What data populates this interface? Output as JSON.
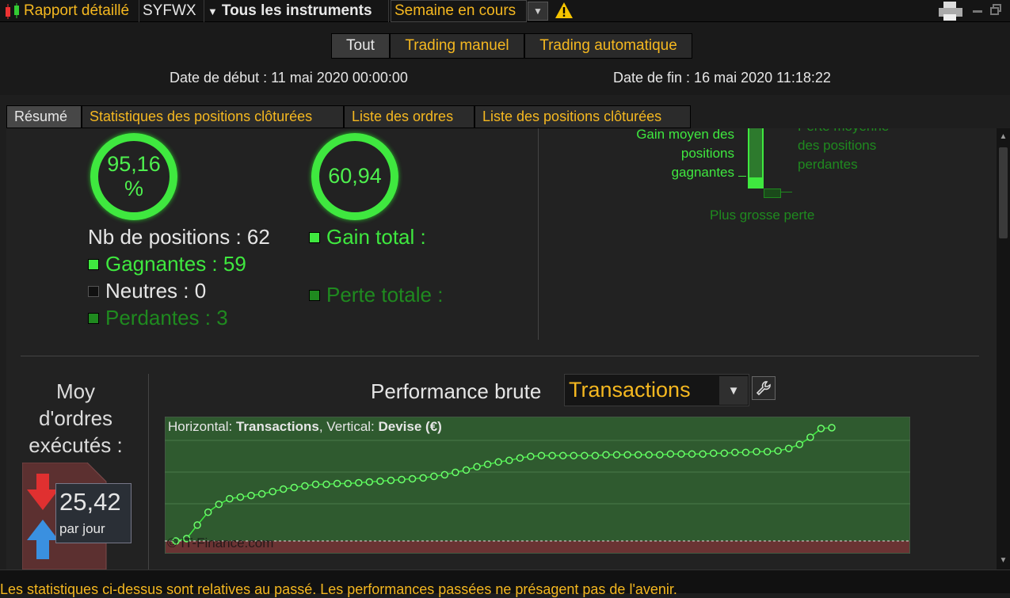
{
  "toolbar": {
    "report_label": "Rapport détaillé",
    "symbol": "SYFWX",
    "instruments": "Tous les instruments",
    "period": "Semaine en cours"
  },
  "filter_tabs": [
    "Tout",
    "Trading manuel",
    "Trading automatique"
  ],
  "dates": {
    "start": "Date de début : 11 mai 2020 00:00:00",
    "end": "Date de fin : 16 mai 2020 11:18:22"
  },
  "tabs": [
    "Résumé",
    "Statistiques des positions clôturées",
    "Liste des ordres",
    "Liste des positions clôturées"
  ],
  "summary": {
    "win_rate": "95,16\n%",
    "ratio": "60,94",
    "positions_count": "Nb de positions : 62",
    "winners": "Gagnantes : 59",
    "neutral": "Neutres : 0",
    "losers": "Perdantes : 3",
    "total_gain": "Gain total :",
    "total_loss": "Perte totale :"
  },
  "bar_labels": {
    "avg_gain": "Gain moyen des\npositions\ngagnantes",
    "avg_loss": "Perte moyenne\ndes positions\nperdantes",
    "biggest_loss": "Plus grosse perte"
  },
  "orders": {
    "label": "Moy\nd'ordres\nexécutés :",
    "value": "25,42",
    "unit": "par jour"
  },
  "performance": {
    "title": "Performance brute",
    "select_value": "Transactions",
    "axis_note_h_label": "Horizontal: ",
    "axis_note_h_value": "Transactions",
    "axis_note_v_label": ", Vertical: ",
    "axis_note_v_value": "Devise (€)",
    "watermark": "© IT-Finance.com"
  },
  "disclaimer": "Les statistiques ci-dessus sont relatives au passé. Les performances passées ne présagent pas de l'avenir.",
  "colors": {
    "accent": "#f5b820",
    "green": "#3fe83f",
    "chart_bg": "#2f5a2f"
  },
  "chart_data": {
    "type": "line",
    "title": "Performance brute",
    "xlabel": "Transactions",
    "ylabel": "Devise (€)",
    "grid": true,
    "legend": "none",
    "series": [
      {
        "values": [
          0.0,
          0.3,
          2.0,
          3.6,
          4.6,
          5.3,
          5.5,
          5.7,
          5.9,
          6.2,
          6.5,
          6.7,
          6.9,
          7.1,
          7.1,
          7.2,
          7.2,
          7.3,
          7.4,
          7.5,
          7.6,
          7.7,
          7.8,
          7.9,
          8.1,
          8.3,
          8.6,
          8.9,
          9.3,
          9.6,
          9.9,
          10.1,
          10.4,
          10.6,
          10.7,
          10.7,
          10.7,
          10.7,
          10.7,
          10.7,
          10.8,
          10.8,
          10.8,
          10.8,
          10.8,
          10.8,
          10.9,
          10.9,
          10.9,
          10.9,
          11.0,
          11.0,
          11.1,
          11.1,
          11.2,
          11.2,
          11.3,
          11.6,
          12.1,
          13.0,
          14.1,
          14.2
        ]
      }
    ]
  }
}
